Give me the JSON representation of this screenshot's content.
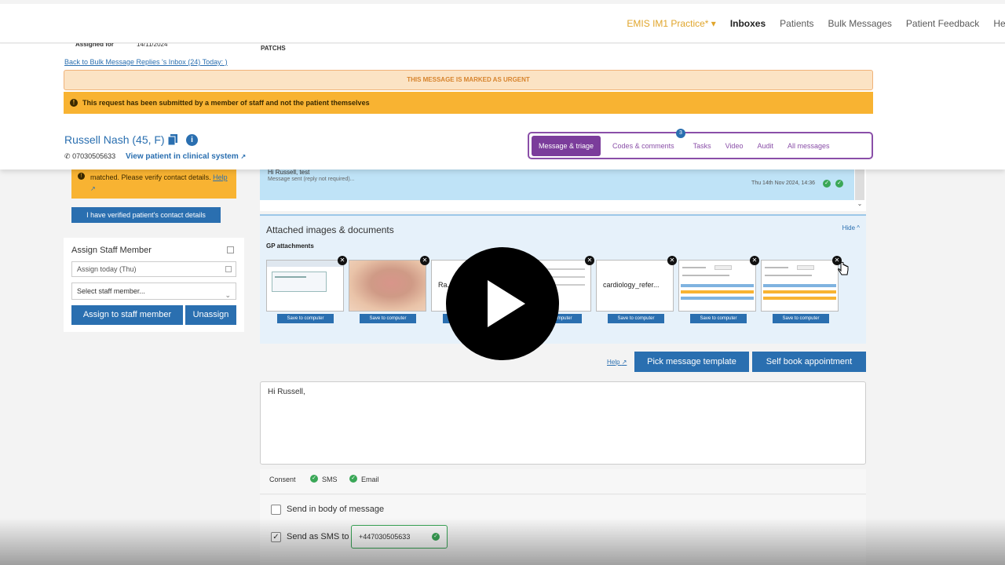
{
  "nav": {
    "practice": "EMIS IM1 Practice* ▾",
    "items": [
      "Inboxes",
      "Patients",
      "Bulk Messages",
      "Patient Feedback",
      "Help"
    ]
  },
  "header": {
    "behind_left": "Assigned for",
    "behind_date": "14/11/2024",
    "behind_right": "PATCHS",
    "back_link": "Back to Bulk Message Replies 's Inbox (24) Today: )",
    "urgent": "THIS MESSAGE IS MARKED AS URGENT",
    "staff_notice": "This request has been submitted by a member of staff and not the patient themselves",
    "patient_name": "Russell Nash (45, F)",
    "phone": "07030505633",
    "view_link": "View patient in clinical system"
  },
  "tabs": {
    "badge": "3",
    "items": [
      "Message & triage",
      "Codes & comments",
      "Tasks",
      "Video",
      "Audit",
      "All messages"
    ]
  },
  "left": {
    "verify_text": "matched. Please verify contact details.",
    "verify_help": "Help",
    "verified_button": "I have verified patient's contact details",
    "assign_title": "Assign Staff Member",
    "assign_date": "Assign today (Thu)",
    "select_placeholder": "Select staff member...",
    "assign_button": "Assign to staff member",
    "unassign_button": "Unassign"
  },
  "message": {
    "line1": "Hi Russell, test",
    "line2": "Message sent (reply not required)...",
    "timestamp": "Thu 14th Nov 2024, 14:36"
  },
  "attachments": {
    "title": "Attached images & documents",
    "hide": "Hide ^",
    "gp_label": "GP attachments",
    "files": [
      {
        "kind": "screenshot",
        "name": ""
      },
      {
        "kind": "photo",
        "name": ""
      },
      {
        "kind": "document",
        "name": "Ra...g..."
      },
      {
        "kind": "screenshot",
        "name": ""
      },
      {
        "kind": "document",
        "name": "cardiology_refer..."
      },
      {
        "kind": "screenshot",
        "name": ""
      },
      {
        "kind": "screenshot",
        "name": ""
      }
    ],
    "save_label": "Save to computer"
  },
  "actions": {
    "help": "Help",
    "pick_template": "Pick message template",
    "self_book": "Self book appointment"
  },
  "compose": {
    "text": "Hi Russell,"
  },
  "consent": {
    "label": "Consent",
    "sms": "SMS",
    "email": "Email"
  },
  "options": {
    "send_body": "Send in body of message",
    "send_sms": "Send as SMS to",
    "sms_number": "+447030505633"
  },
  "colors": {
    "brand_blue": "#2a6fb0",
    "urgent_orange": "#f8b332",
    "tab_purple": "#7b3d9b",
    "ok_green": "#3aa757"
  }
}
